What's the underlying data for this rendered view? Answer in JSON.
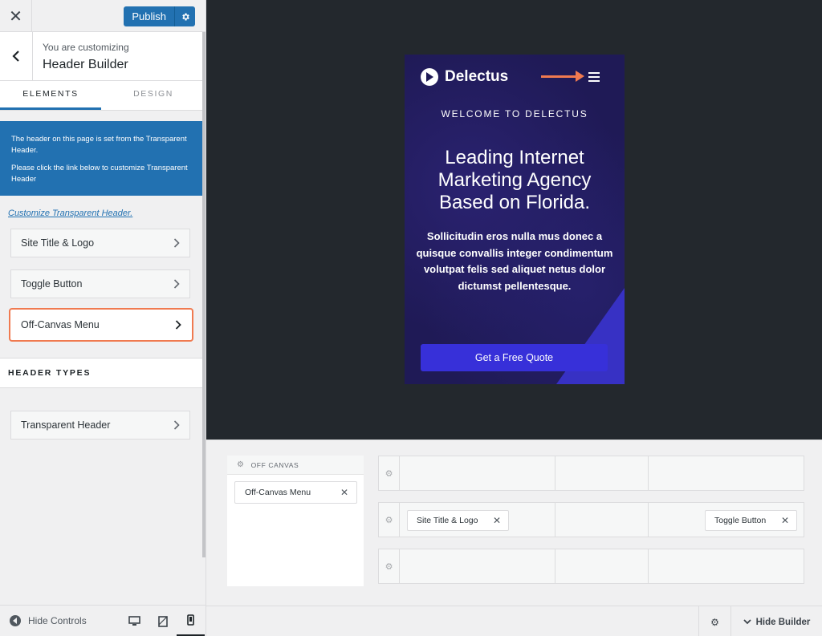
{
  "topbar": {
    "close_label": "✕",
    "publish_label": "Publish"
  },
  "customizing": {
    "subtitle": "You are customizing",
    "title": "Header Builder"
  },
  "tabs": [
    {
      "label": "ELEMENTS",
      "active": true
    },
    {
      "label": "DESIGN",
      "active": false
    }
  ],
  "notice": {
    "line1": "The header on this page is set from the Transparent Header.",
    "line2": "Please click the link below to customize Transparent Header"
  },
  "customize_link": "Customize Transparent Header.",
  "elements": [
    {
      "label": "Site Title & Logo"
    },
    {
      "label": "Toggle Button"
    },
    {
      "label": "Off-Canvas Menu",
      "highlighted": true
    }
  ],
  "header_types": {
    "heading": "HEADER TYPES",
    "items": [
      {
        "label": "Transparent Header"
      }
    ]
  },
  "bottombar": {
    "hide_controls": "Hide Controls",
    "active_device": "mobile"
  },
  "preview": {
    "logo_text": "Delectus",
    "welcome": "WELCOME TO DELECTUS",
    "headline_lines": [
      "Leading Internet",
      "Marketing Agency",
      "Based on Florida."
    ],
    "paragraph": "Sollicitudin eros nulla mus donec a quisque convallis integer condimentum volutpat felis sed aliquet netus dolor dictumst pellentesque.",
    "cta": "Get a Free Quote",
    "colors": {
      "bg": "#1f1a56",
      "accent": "#3730d9",
      "arrow": "#f07a50"
    }
  },
  "builder": {
    "offcanvas_label": "OFF CANVAS",
    "offcanvas_item": "Off-Canvas Menu",
    "site_chip": "Site Title & Logo",
    "toggle_chip": "Toggle Button",
    "hide_builder": "Hide Builder"
  },
  "colors": {
    "wp_blue": "#2271b1",
    "highlight": "#f07a50"
  }
}
